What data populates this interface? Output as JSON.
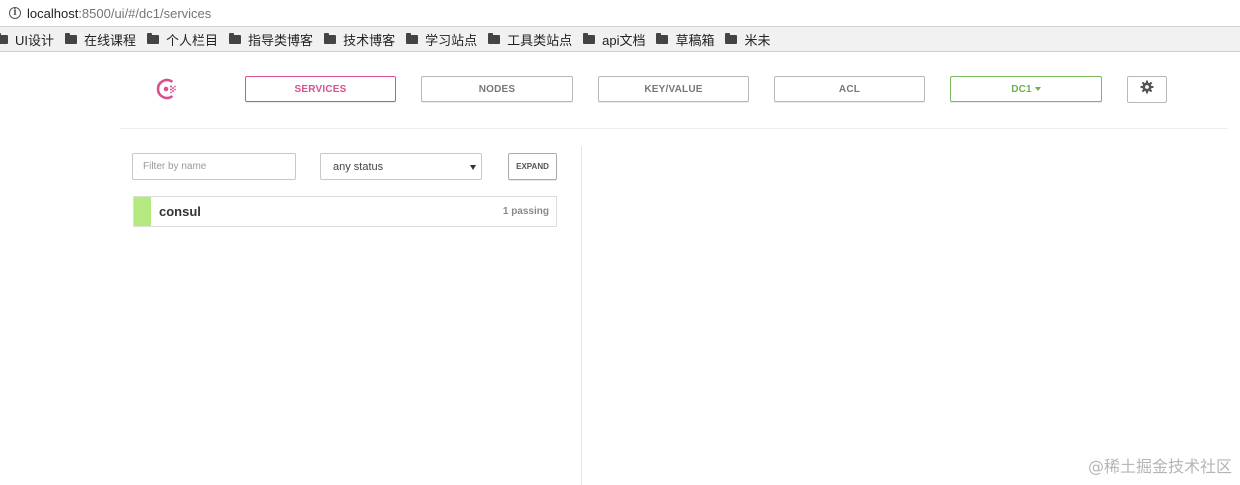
{
  "browser": {
    "url_host": "localhost",
    "url_rest": ":8500/ui/#/dc1/services",
    "bookmarks": [
      "UI设计",
      "在线课程",
      "个人栏目",
      "指导类博客",
      "技术博客",
      "学习站点",
      "工具类站点",
      "api文档",
      "草稿箱",
      "米未"
    ]
  },
  "nav": {
    "services": "SERVICES",
    "nodes": "NODES",
    "keyvalue": "KEY/VALUE",
    "acl": "ACL",
    "datacenter": "DC1",
    "accent_color": "#d9518d",
    "dc_color": "#6eaf4e"
  },
  "filter": {
    "placeholder": "Filter by name",
    "status_value": "any status",
    "expand_label": "EXPAND"
  },
  "services": [
    {
      "name": "consul",
      "status": "1 passing",
      "health_color": "#b4ea7f"
    }
  ],
  "watermark": "@稀土掘金技术社区"
}
